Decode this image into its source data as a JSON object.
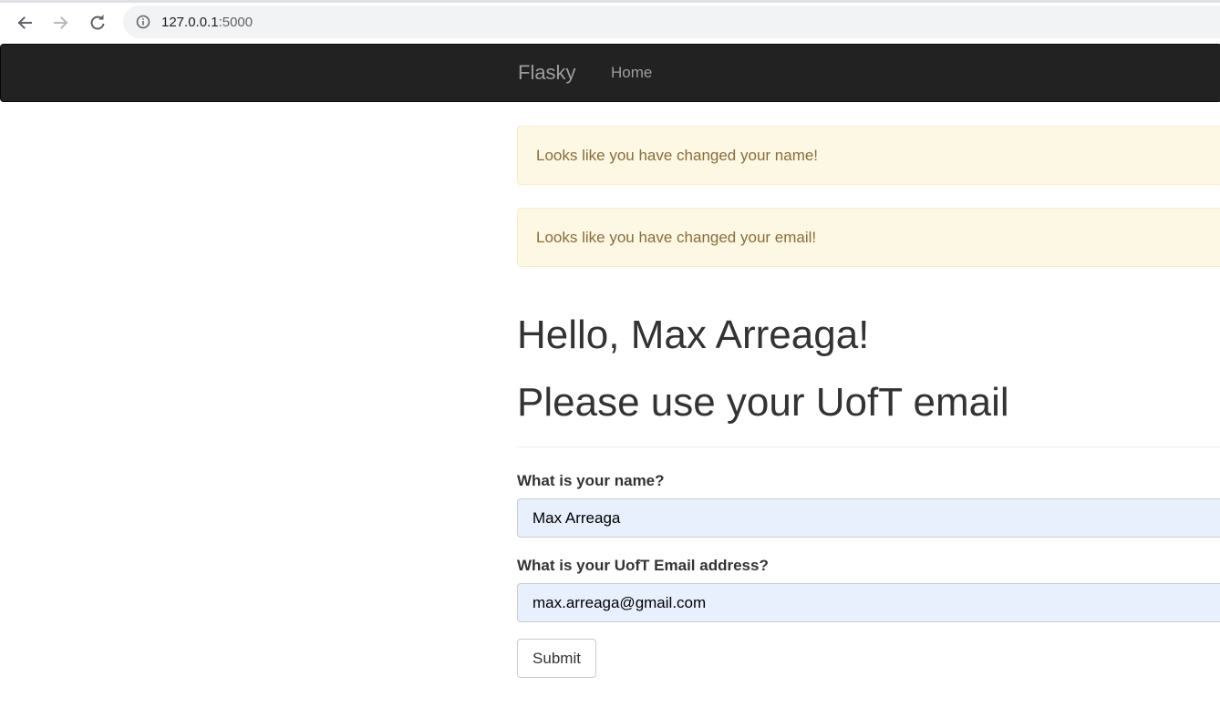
{
  "browser": {
    "url_host": "127.0.0.1",
    "url_port": ":5000"
  },
  "navbar": {
    "brand": "Flasky",
    "links": [
      {
        "label": "Home"
      }
    ],
    "background_color": "#222222"
  },
  "alerts": [
    {
      "text": "Looks like you have changed your name!"
    },
    {
      "text": "Looks like you have changed your email!"
    }
  ],
  "page": {
    "greeting": "Hello, Max Arreaga!",
    "subheading": "Please use your UofT email"
  },
  "form": {
    "name_label": "What is your name?",
    "name_value": "Max Arreaga",
    "email_label": "What is your UofT Email address?",
    "email_value": "max.arreaga@gmail.com",
    "submit_label": "Submit"
  },
  "icons": {
    "back": "arrow-left-icon",
    "forward": "arrow-right-icon",
    "reload": "reload-icon",
    "site_info": "info-icon"
  },
  "colors": {
    "alert_background": "#fcf8e3",
    "alert_text": "#8a6d3b",
    "autofill_background": "#e8f0fe"
  }
}
